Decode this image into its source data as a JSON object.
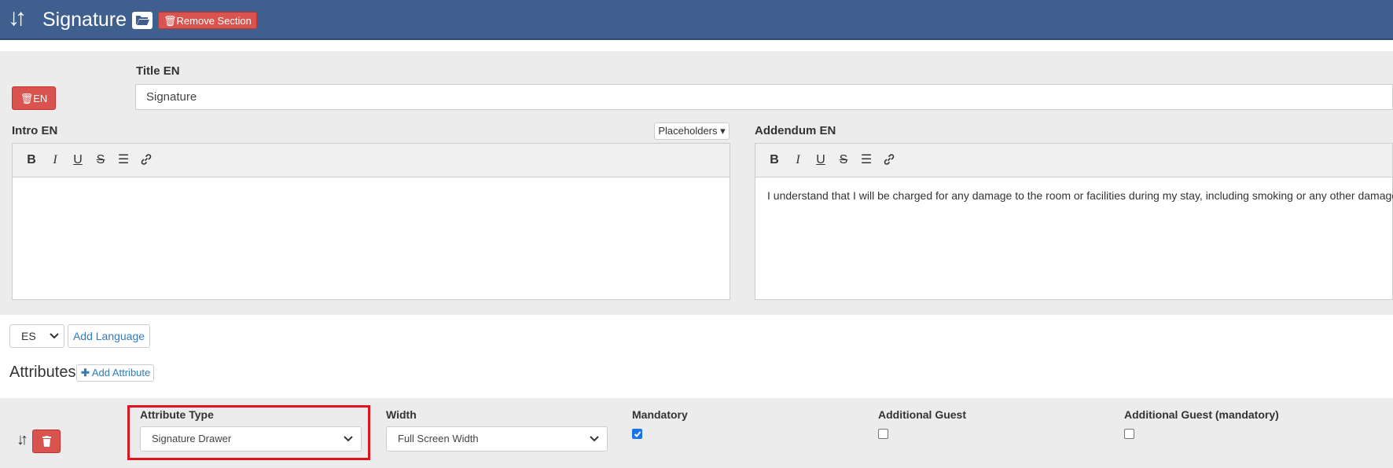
{
  "header": {
    "title": "Signature",
    "remove_section_label": "Remove Section"
  },
  "title_field": {
    "label": "Title EN",
    "value": "Signature",
    "lang_button": "EN"
  },
  "intro": {
    "label": "Intro EN",
    "placeholders_button": "Placeholders",
    "content": ""
  },
  "addendum": {
    "label": "Addendum EN",
    "content": "I understand that I will be charged for any damage to the room or facilities during my stay, including smoking or any other damage."
  },
  "language": {
    "selected": "ES",
    "add_language_label": "Add Language"
  },
  "attributes": {
    "title": "Attributes",
    "add_attribute_label": "Add Attribute",
    "attribute_type_label": "Attribute Type",
    "attribute_type_value": "Signature Drawer",
    "width_label": "Width",
    "width_value": "Full Screen Width",
    "mandatory_label": "Mandatory",
    "mandatory_checked": true,
    "additional_guest_label": "Additional Guest",
    "additional_guest_checked": false,
    "additional_guest_mandatory_label": "Additional Guest (mandatory)",
    "additional_guest_mandatory_checked": false
  },
  "colors": {
    "header_bg": "#3f5f8f",
    "danger": "#d9534f",
    "link": "#337ab7",
    "highlight": "#e0141e"
  }
}
